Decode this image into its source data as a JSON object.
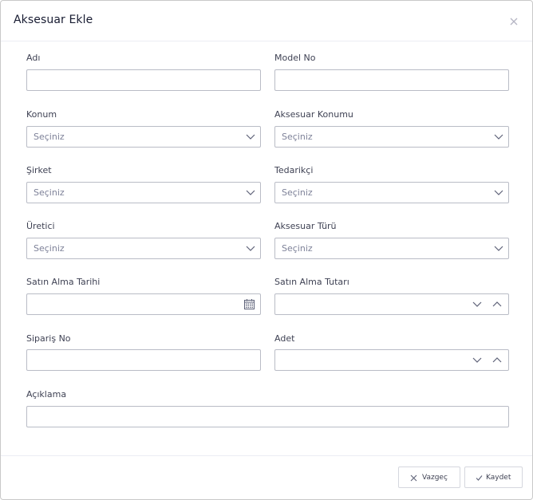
{
  "modal": {
    "title": "Aksesuar Ekle",
    "close_icon": "close-icon"
  },
  "form": {
    "adi": {
      "label": "Adı",
      "value": ""
    },
    "model_no": {
      "label": "Model No",
      "value": ""
    },
    "konum": {
      "label": "Konum",
      "placeholder": "Seçiniz"
    },
    "aksesuar_konumu": {
      "label": "Aksesuar Konumu",
      "placeholder": "Seçiniz"
    },
    "sirket": {
      "label": "Şirket",
      "placeholder": "Seçiniz"
    },
    "tedarikci": {
      "label": "Tedarikçi",
      "placeholder": "Seçiniz"
    },
    "uretici": {
      "label": "Üretici",
      "placeholder": "Seçiniz"
    },
    "aksesuar_turu": {
      "label": "Aksesuar Türü",
      "placeholder": "Seçiniz"
    },
    "satin_alma_tarihi": {
      "label": "Satın Alma Tarihi",
      "value": "",
      "icon": "calendar-icon"
    },
    "satin_alma_tutari": {
      "label": "Satın Alma Tutarı",
      "value": ""
    },
    "siparis_no": {
      "label": "Sipariş No",
      "value": ""
    },
    "adet": {
      "label": "Adet",
      "value": ""
    },
    "aciklama": {
      "label": "Açıklama",
      "value": ""
    }
  },
  "footer": {
    "cancel_label": "Vazgeç",
    "save_label": "Kaydet"
  }
}
